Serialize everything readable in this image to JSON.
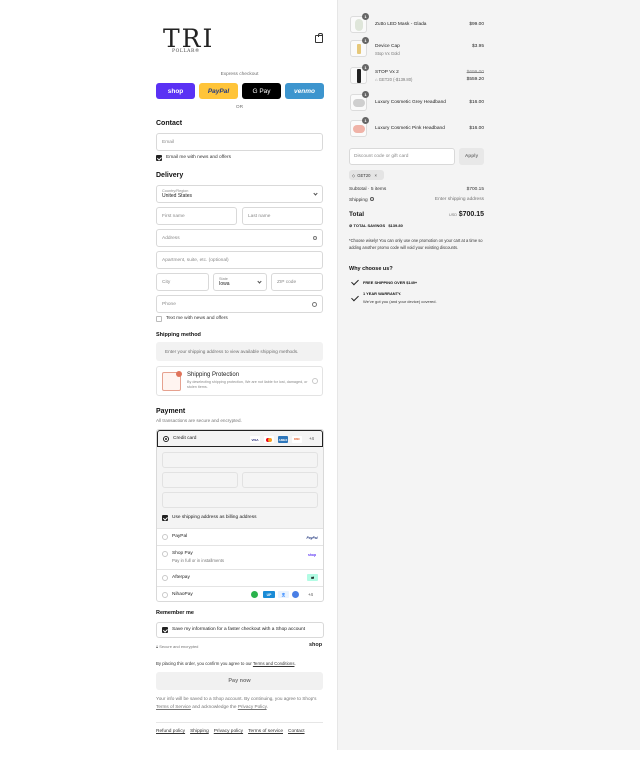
{
  "logo": {
    "main": "TRI",
    "sub": "POLLAR®"
  },
  "express": {
    "label": "Express checkout",
    "buttons": [
      {
        "name": "shop",
        "label": "shop",
        "bg": "#5a31f4",
        "fg": "#ffffff"
      },
      {
        "name": "paypal",
        "label": "PayPal",
        "bg": "#ffc439",
        "fg": "#253b80"
      },
      {
        "name": "gpay",
        "label": "G Pay",
        "bg": "#000000",
        "fg": "#ffffff"
      },
      {
        "name": "venmo",
        "label": "venmo",
        "bg": "#3d95ce",
        "fg": "#ffffff"
      }
    ],
    "or": "OR"
  },
  "contact": {
    "title": "Contact",
    "email_placeholder": "Email",
    "newsletter": "Email me with news and offers"
  },
  "delivery": {
    "title": "Delivery",
    "country_label": "Country/Region",
    "country_value": "United States",
    "first_name": "First name",
    "last_name": "Last name",
    "address": "Address",
    "apartment": "Apartment, suite, etc. (optional)",
    "city": "City",
    "state_label": "State",
    "state_value": "Iowa",
    "zip": "ZIP code",
    "phone": "Phone",
    "text_offers": "Text me with news and offers"
  },
  "shipping": {
    "title": "Shipping method",
    "info": "Enter your shipping address to view available shipping methods."
  },
  "protection": {
    "title": "Shipping Protection",
    "desc": "By deselecting shipping protection, We are not liable for lost, damaged, or stolen items."
  },
  "payment": {
    "title": "Payment",
    "subtitle": "All transactions are secure and encrypted.",
    "credit_card": "Credit card",
    "more_cards": "+4",
    "billing_same": "Use shipping address as billing address",
    "methods": [
      {
        "label": "PayPal",
        "sub": ""
      },
      {
        "label": "Shop Pay",
        "sub": "Pay in full or in installments"
      },
      {
        "label": "Afterpay",
        "sub": ""
      },
      {
        "label": "NihaoPay",
        "sub": ""
      }
    ],
    "nihao_more": "+4",
    "paypal_logo": "PayPal",
    "shop_logo": "shop"
  },
  "remember": {
    "title": "Remember me",
    "save_label": "Save my information for a faster checkout with a Shop account",
    "secure": "Secure and encrypted",
    "shop": "shop"
  },
  "terms": {
    "prefix": "By placing this order, you confirm you agree to our ",
    "link": "Terms and Conditions",
    "suffix": "."
  },
  "paynow": "Pay now",
  "shop_notice": {
    "part1": "Your info will be saved to a Shop account. By continuing, you agree to Shop's ",
    "tos": "Terms of Service",
    "part2": " and acknowledge the ",
    "privacy": "Privacy Policy",
    "part3": "."
  },
  "footer": [
    "Refund policy",
    "Shipping",
    "Privacy policy",
    "Terms of service",
    "Contact"
  ],
  "cart": {
    "items": [
      {
        "qty": "1",
        "name": "Zutto LED Mask - Glada",
        "sub": "",
        "price": "$99.00",
        "orig": ""
      },
      {
        "qty": "1",
        "name": "Device Cap",
        "sub": "Stop Vx Gold",
        "price": "$3.95",
        "orig": ""
      },
      {
        "qty": "1",
        "name": "STOP Vx 2",
        "sub": "GET20 (-$139.80)",
        "price": "$559.20",
        "orig": "$699.00"
      },
      {
        "qty": "1",
        "name": "Luxury Cosmetic Grey Headband",
        "sub": "",
        "price": "$16.00",
        "orig": ""
      },
      {
        "qty": "1",
        "name": "Luxury Cosmetic Pink Headband",
        "sub": "",
        "price": "$16.00",
        "orig": ""
      }
    ],
    "discount_placeholder": "Discount code or gift card",
    "apply": "Apply",
    "code": "GET20",
    "subtotal_label": "Subtotal · 5 items",
    "subtotal": "$700.15",
    "shipping_label": "Shipping",
    "shipping_value": "Enter shipping address",
    "total_label": "Total",
    "currency": "USD",
    "total": "$700.15",
    "savings_label": "TOTAL SAVINGS",
    "savings": "$139.80",
    "note": "*Choose wisely! You can only use one promotion on your cart at a time so adding another promo code will void your existing discounts.",
    "why_title": "Why choose us?",
    "why": [
      {
        "title": "FREE SHIPPING OVER $149+",
        "sub": ""
      },
      {
        "title": "1 YEAR WARRANTY.",
        "sub": "We've got you (and your device) covered."
      }
    ]
  }
}
